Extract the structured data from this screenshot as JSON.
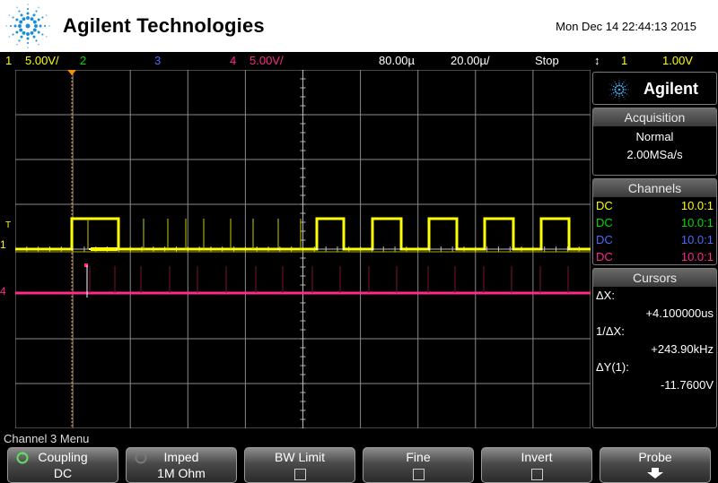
{
  "header": {
    "brand": "Agilent Technologies",
    "datetime": "Mon Dec 14 22:44:13 2015"
  },
  "status_bar": {
    "ch1_num": "1",
    "ch1_scale": "5.00V/",
    "ch2_num": "2",
    "ch3_num": "3",
    "ch4_num": "4",
    "ch4_scale": "5.00V/",
    "time_delay": "80.00µ",
    "time_scale": "20.00µ/",
    "run_state": "Stop",
    "trigger_icon": "↕",
    "trigger_source": "1",
    "trigger_level": "1.00V"
  },
  "side_panel": {
    "logo_text": "Agilent",
    "acquisition": {
      "title": "Acquisition",
      "mode": "Normal",
      "rate": "2.00MSa/s"
    },
    "channels": {
      "title": "Channels",
      "rows": [
        {
          "coupling": "DC",
          "probe": "10.0:1",
          "color": "#ffff00"
        },
        {
          "coupling": "DC",
          "probe": "10.0:1",
          "color": "#00dd00"
        },
        {
          "coupling": "DC",
          "probe": "10.0:1",
          "color": "#4c6bff"
        },
        {
          "coupling": "DC",
          "probe": "10.0:1",
          "color": "#ff2a8a"
        }
      ]
    },
    "cursors": {
      "title": "Cursors",
      "dx_label": "ΔX:",
      "dx_value": "+4.100000us",
      "inv_dx_label": "1/ΔX:",
      "inv_dx_value": "+243.90kHz",
      "dy_label": "ΔY(1):",
      "dy_value": "-11.7600V"
    }
  },
  "screen": {
    "ch1_marker": "1",
    "ch4_marker": "4",
    "trigger_marker": "T"
  },
  "menu": {
    "title": "Channel 3 Menu",
    "softkeys": [
      {
        "label": "Coupling",
        "value": "DC",
        "icon": "rotary-knob-icon"
      },
      {
        "label": "Imped",
        "value": "1M Ohm",
        "icon": "rotary-knob-icon"
      },
      {
        "label": "BW Limit",
        "value": "",
        "icon": "checkbox"
      },
      {
        "label": "Fine",
        "value": "",
        "icon": "checkbox"
      },
      {
        "label": "Invert",
        "value": "",
        "icon": "checkbox"
      },
      {
        "label": "Probe",
        "value": "",
        "icon": "down-arrow-icon"
      }
    ]
  },
  "colors": {
    "ch1": "#ffff00",
    "ch2": "#00dd00",
    "ch3": "#4c6bff",
    "ch4": "#ff2a8a",
    "trigger_cursor": "#ff8c00"
  }
}
